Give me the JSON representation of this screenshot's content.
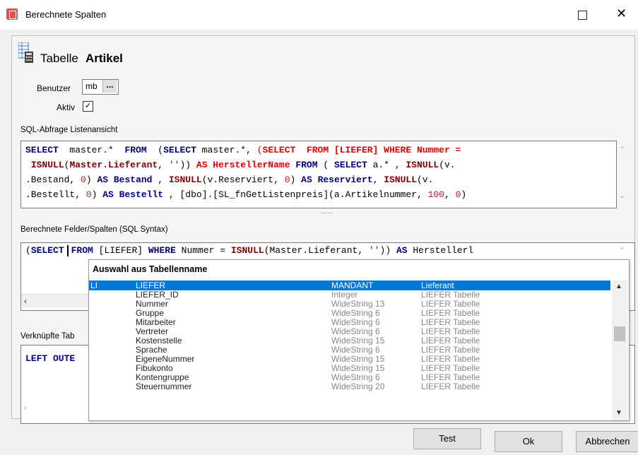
{
  "window": {
    "title": "Berechnete Spalten",
    "maximize_icon": "maximize-icon",
    "close_icon": "close-icon",
    "close_glyph": "✕"
  },
  "header": {
    "label": "Tabelle",
    "name": "Artikel"
  },
  "benutzer": {
    "label": "Benutzer",
    "value": "mb",
    "button": "..."
  },
  "aktiv": {
    "label": "Aktiv",
    "checked": true,
    "mark": "✓"
  },
  "sql_list": {
    "label": "SQL-Abfrage Listenansicht",
    "lines": [
      "SELECT  master.*  FROM  (SELECT master.*, (SELECT  FROM [LIEFER] WHERE Nummer =",
      " ISNULL(Master.Lieferant, '')) AS HerstellerName FROM ( SELECT a.* , ISNULL(v.",
      ".Bestand, 0) AS Bestand , ISNULL(v.Reserviert, 0) AS Reserviert, ISNULL(v.",
      ".Bestellt, 0) AS Bestellt , [dbo].[SL_fnGetListenpreis](a.Artikelnummer, 100, 0)"
    ]
  },
  "sql_fields": {
    "label": "Berechnete Felder/Spalten (SQL Syntax)",
    "line": "(SELECT  FROM [LIEFER] WHERE Nummer = ISNULL(Master.Lieferant, '')) AS Herstellerl"
  },
  "verknuepft": {
    "label": "Verknüpfte Tab",
    "line": "LEFT OUTE"
  },
  "popup": {
    "title": "Auswahl aus Tabellenname",
    "rows": [
      {
        "prefix": "LI",
        "name": "LIEFER",
        "type": "MANDANT",
        "desc": "Lieferant",
        "selected": true
      },
      {
        "prefix": "",
        "name": "LIEFER_ID",
        "type": "Integer",
        "desc": "LIEFER Tabelle"
      },
      {
        "prefix": "",
        "name": "Nummer",
        "type": "WideString  13",
        "desc": "LIEFER Tabelle"
      },
      {
        "prefix": "",
        "name": "Gruppe",
        "type": "WideString  6",
        "desc": "LIEFER Tabelle"
      },
      {
        "prefix": "",
        "name": "Mitarbeiter",
        "type": "WideString  6",
        "desc": "LIEFER Tabelle"
      },
      {
        "prefix": "",
        "name": "Vertreter",
        "type": "WideString  6",
        "desc": "LIEFER Tabelle"
      },
      {
        "prefix": "",
        "name": "Kostenstelle",
        "type": "WideString  15",
        "desc": "LIEFER Tabelle"
      },
      {
        "prefix": "",
        "name": "Sprache",
        "type": "WideString  6",
        "desc": "LIEFER Tabelle"
      },
      {
        "prefix": "",
        "name": "EigeneNummer",
        "type": "WideString  15",
        "desc": "LIEFER Tabelle"
      },
      {
        "prefix": "",
        "name": "Fibukonto",
        "type": "WideString  15",
        "desc": "LIEFER Tabelle"
      },
      {
        "prefix": "",
        "name": "Kontengruppe",
        "type": "WideString  6",
        "desc": "LIEFER Tabelle"
      },
      {
        "prefix": "",
        "name": "Steuernummer",
        "type": "WideString  20",
        "desc": "LIEFER Tabelle"
      }
    ]
  },
  "buttons": {
    "test": "Test",
    "ok": "Ok",
    "cancel": "Abbrechen"
  },
  "colors": {
    "keyword": "#00007f",
    "keyword_red": "#e00000",
    "selection": "#0078d7"
  }
}
